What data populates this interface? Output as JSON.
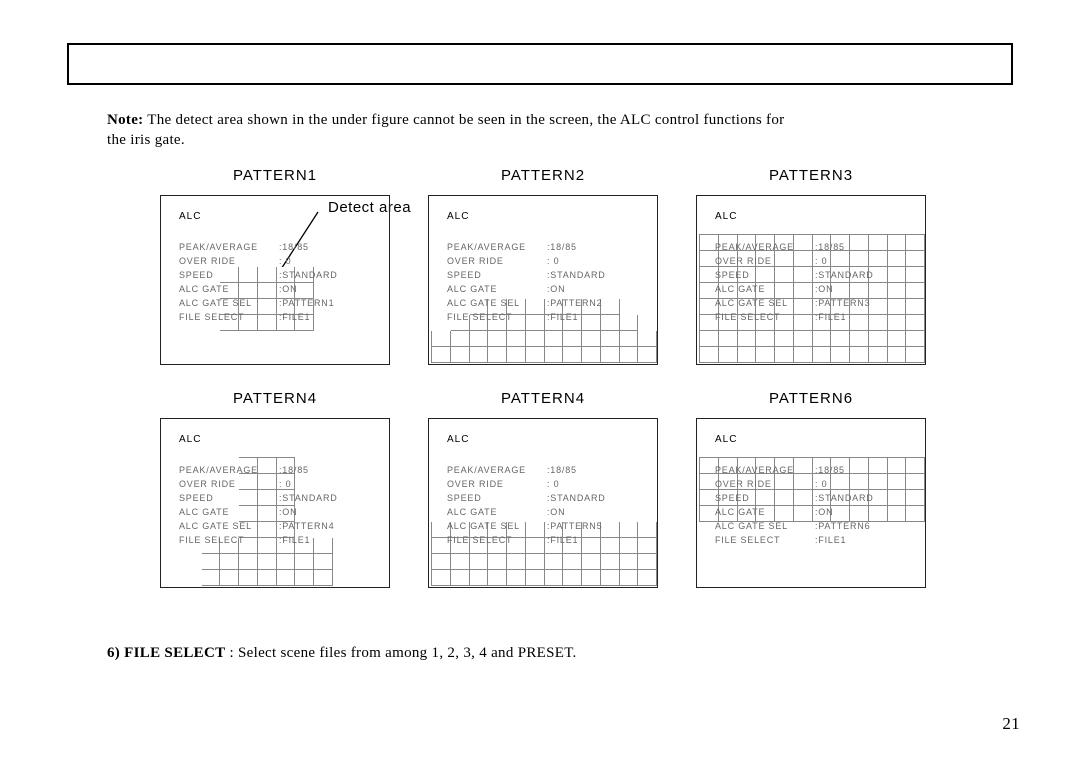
{
  "note": {
    "label": "Note:",
    "text_1": " The detect area shown in the under figure cannot be seen in the screen, the ALC control functions for",
    "text_2": "the iris gate."
  },
  "detect_area_label": "Detect area",
  "patterns": [
    {
      "title": "PATTERN1",
      "alc": "ALC",
      "rows": [
        [
          "PEAK/AVERAGE",
          "18/85"
        ],
        [
          "OVER RIDE",
          " 0"
        ],
        [
          "SPEED",
          "STANDARD"
        ],
        [
          "ALC GATE",
          "ON"
        ],
        [
          "ALC GATE SEL",
          "PATTERN1"
        ],
        [
          "FILE SELECT",
          "FILE1"
        ]
      ],
      "shape": "center_block"
    },
    {
      "title": "PATTERN2",
      "alc": "ALC",
      "rows": [
        [
          "PEAK/AVERAGE",
          "18/85"
        ],
        [
          "OVER RIDE",
          " 0"
        ],
        [
          "SPEED",
          "STANDARD"
        ],
        [
          "ALC GATE",
          "ON"
        ],
        [
          "ALC GATE SEL",
          "PATTERN2"
        ],
        [
          "FILE SELECT",
          "FILE1"
        ]
      ],
      "shape": "trapezoid_down"
    },
    {
      "title": "PATTERN3",
      "alc": "ALC",
      "rows": [
        [
          "PEAK/AVERAGE",
          "18/85"
        ],
        [
          "OVER RIDE",
          " 0"
        ],
        [
          "SPEED",
          "STANDARD"
        ],
        [
          "ALC GATE",
          "ON"
        ],
        [
          "ALC GATE SEL",
          "PATTERN3"
        ],
        [
          "FILE SELECT",
          "FILE1"
        ]
      ],
      "shape": "full"
    },
    {
      "title": "PATTERN4",
      "alc": "ALC",
      "rows": [
        [
          "PEAK/AVERAGE",
          "18/85"
        ],
        [
          "OVER RIDE",
          " 0"
        ],
        [
          "SPEED",
          "STANDARD"
        ],
        [
          "ALC GATE",
          "ON"
        ],
        [
          "ALC GATE SEL",
          "PATTERN4"
        ],
        [
          "FILE SELECT",
          "FILE1"
        ]
      ],
      "shape": "stem_t"
    },
    {
      "title": "PATTERN4",
      "alc": "ALC",
      "rows": [
        [
          "PEAK/AVERAGE",
          "18/85"
        ],
        [
          "OVER RIDE",
          " 0"
        ],
        [
          "SPEED",
          "STANDARD"
        ],
        [
          "ALC GATE",
          "ON"
        ],
        [
          "ALC GATE SEL",
          "PATTERN5"
        ],
        [
          "FILE SELECT",
          "FILE1"
        ]
      ],
      "shape": "bottom4"
    },
    {
      "title": "PATTERN6",
      "alc": "ALC",
      "rows": [
        [
          "PEAK/AVERAGE",
          "18/85"
        ],
        [
          "OVER RIDE",
          " 0"
        ],
        [
          "SPEED",
          "STANDARD"
        ],
        [
          "ALC GATE",
          "ON"
        ],
        [
          "ALC GATE SEL",
          "PATTERN6"
        ],
        [
          "FILE SELECT",
          "FILE1"
        ]
      ],
      "shape": "top4"
    }
  ],
  "item6": {
    "num": "6)",
    "label": "FILE SELECT",
    "colon": " : ",
    "text": "Select scene files from among 1, 2, 3, 4 and PRESET."
  },
  "page_number": "21"
}
